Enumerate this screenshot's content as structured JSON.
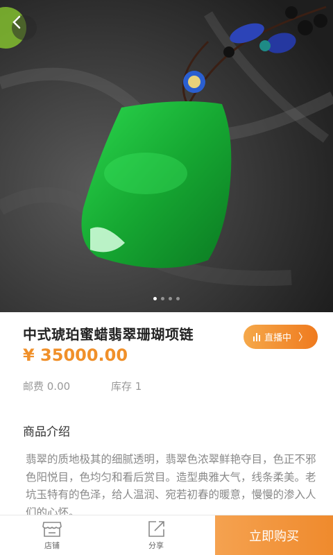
{
  "product": {
    "title": "中式琥珀蜜蜡翡翠珊瑚项链",
    "price": "¥ 35000.00",
    "shipping": "邮费 0.00",
    "stock": "库存 1"
  },
  "live": {
    "label": "直播中",
    "icon": "live-bars-icon"
  },
  "gallery": {
    "dot_count": 4,
    "active_index": 0
  },
  "intro": {
    "heading": "商品介绍",
    "text": "翡翠的质地极其的细腻透明，翡翠色浓翠鲜艳夺目，色正不邪色阳悦目，色均匀和看后赏目。造型典雅大气，线条柔美。老坑玉特有的色泽，给人温润、宛若初春的暖意，慢慢的渗入人们的心怀。"
  },
  "bottom_bar": {
    "store_label": "店铺",
    "share_label": "分享",
    "buy_label": "立即购买"
  },
  "colors": {
    "accent": "#f0902a",
    "jade": "#19b23a",
    "buy_gradient_start": "#f5a250",
    "buy_gradient_end": "#ef8a2d"
  }
}
